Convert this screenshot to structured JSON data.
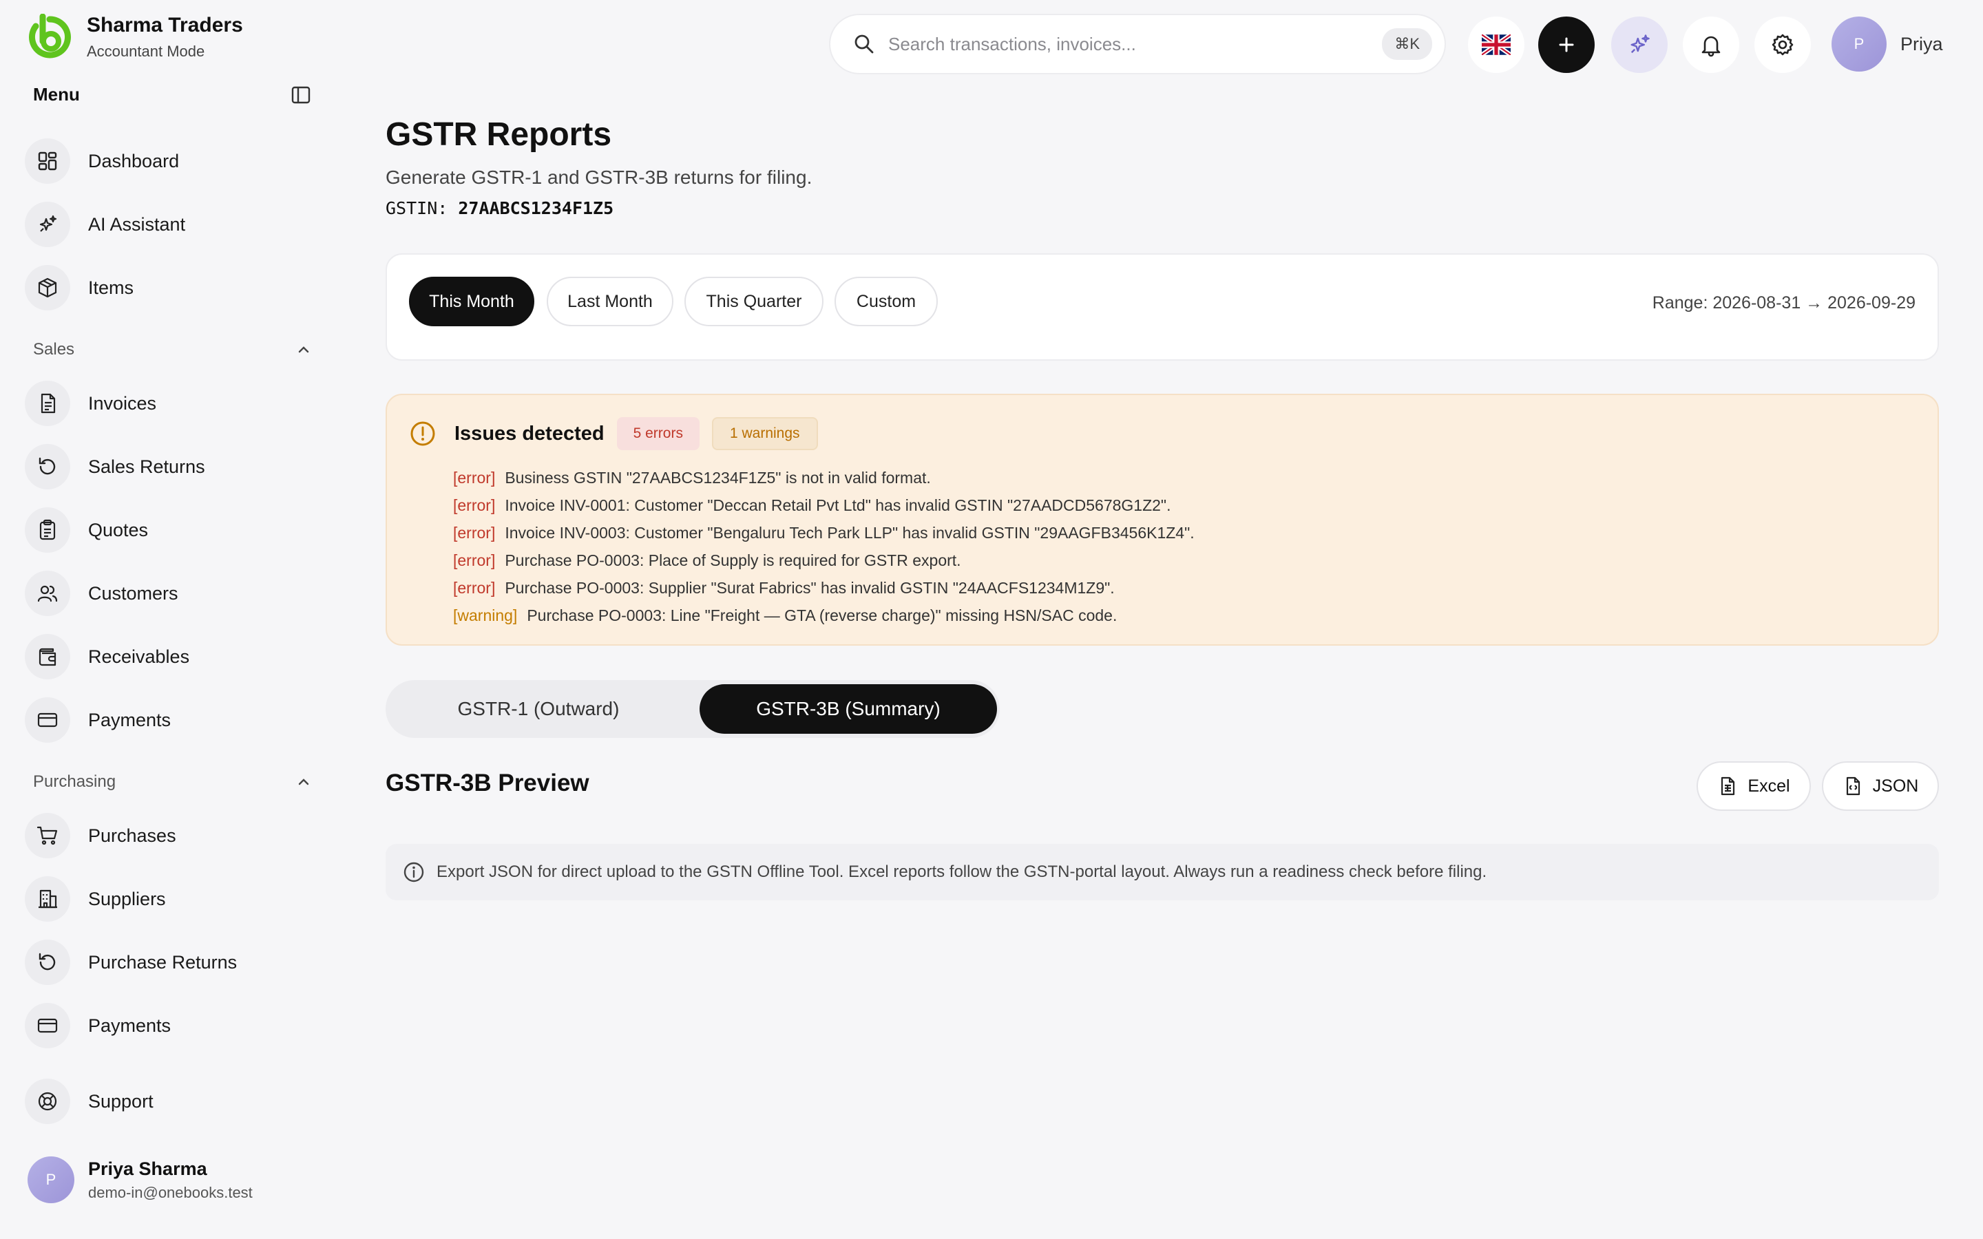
{
  "brand": {
    "name": "Sharma Traders",
    "mode": "Accountant Mode"
  },
  "sidebar": {
    "menu_title": "Menu",
    "top_items": [
      {
        "label": "Dashboard",
        "icon": "dashboard-icon"
      },
      {
        "label": "AI Assistant",
        "icon": "sparkles-icon"
      },
      {
        "label": "Items",
        "icon": "box-icon"
      }
    ],
    "sales": {
      "label": "Sales",
      "items": [
        {
          "label": "Invoices",
          "icon": "document-icon"
        },
        {
          "label": "Sales Returns",
          "icon": "rotate-icon"
        },
        {
          "label": "Quotes",
          "icon": "clipboard-icon"
        },
        {
          "label": "Customers",
          "icon": "users-icon"
        },
        {
          "label": "Receivables",
          "icon": "wallet-icon"
        },
        {
          "label": "Payments",
          "icon": "card-icon"
        }
      ]
    },
    "purchasing": {
      "label": "Purchasing",
      "items": [
        {
          "label": "Purchases",
          "icon": "cart-icon"
        },
        {
          "label": "Suppliers",
          "icon": "building-icon"
        },
        {
          "label": "Purchase Returns",
          "icon": "rotate-icon"
        },
        {
          "label": "Payments",
          "icon": "card-icon"
        }
      ]
    },
    "support_label": "Support",
    "user": {
      "avatar_initial": "P",
      "name": "Priya Sharma",
      "email": "demo-in@onebooks.test"
    }
  },
  "topbar": {
    "search_placeholder": "Search transactions, invoices...",
    "shortcut": "⌘K",
    "profile_initial": "P",
    "profile_name": "Priya"
  },
  "page": {
    "title": "GSTR Reports",
    "subtitle": "Generate GSTR-1 and GSTR-3B returns for filing.",
    "gstin_label": "GSTIN:",
    "gstin_value": "27AABCS1234F1Z5"
  },
  "range": {
    "options": [
      "This Month",
      "Last Month",
      "This Quarter",
      "Custom"
    ],
    "active": "This Month",
    "text": "Range: 2026-08-31 → 2026-09-29"
  },
  "issues": {
    "title": "Issues detected",
    "errors_badge": "5 errors",
    "warnings_badge": "1 warnings",
    "list": [
      {
        "tag": "[error]",
        "text": "Business GSTIN \"27AABCS1234F1Z5\" is not in valid format."
      },
      {
        "tag": "[error]",
        "text": "Invoice INV-0001: Customer \"Deccan Retail Pvt Ltd\" has invalid GSTIN \"27AADCD5678G1Z2\"."
      },
      {
        "tag": "[error]",
        "text": "Invoice INV-0003: Customer \"Bengaluru Tech Park LLP\" has invalid GSTIN \"29AAGFB3456K1Z4\"."
      },
      {
        "tag": "[error]",
        "text": "Purchase PO-0003: Place of Supply is required for GSTR export."
      },
      {
        "tag": "[error]",
        "text": "Purchase PO-0003: Supplier \"Surat Fabrics\" has invalid GSTIN \"24AACFS1234M1Z9\"."
      },
      {
        "tag": "[warning]",
        "text": "Purchase PO-0003: Line \"Freight — GTA (reverse charge)\" missing HSN/SAC code."
      }
    ]
  },
  "tabs": {
    "gstr1": "GSTR-1 (Outward)",
    "gstr3b": "GSTR-3B (Summary)",
    "active": "GSTR-3B (Summary)"
  },
  "preview": {
    "title": "GSTR-3B Preview",
    "excel_label": "Excel",
    "json_label": "JSON",
    "info": "Export JSON for direct upload to the GSTN Offline Tool. Excel reports follow the GSTN-portal layout. Always run a readiness check before filing."
  },
  "colors": {
    "accent_green": "#5fc41e",
    "error": "#c0392b",
    "warning": "#c47d00",
    "dark": "#111111",
    "ai_purple": "#6b63c9"
  }
}
